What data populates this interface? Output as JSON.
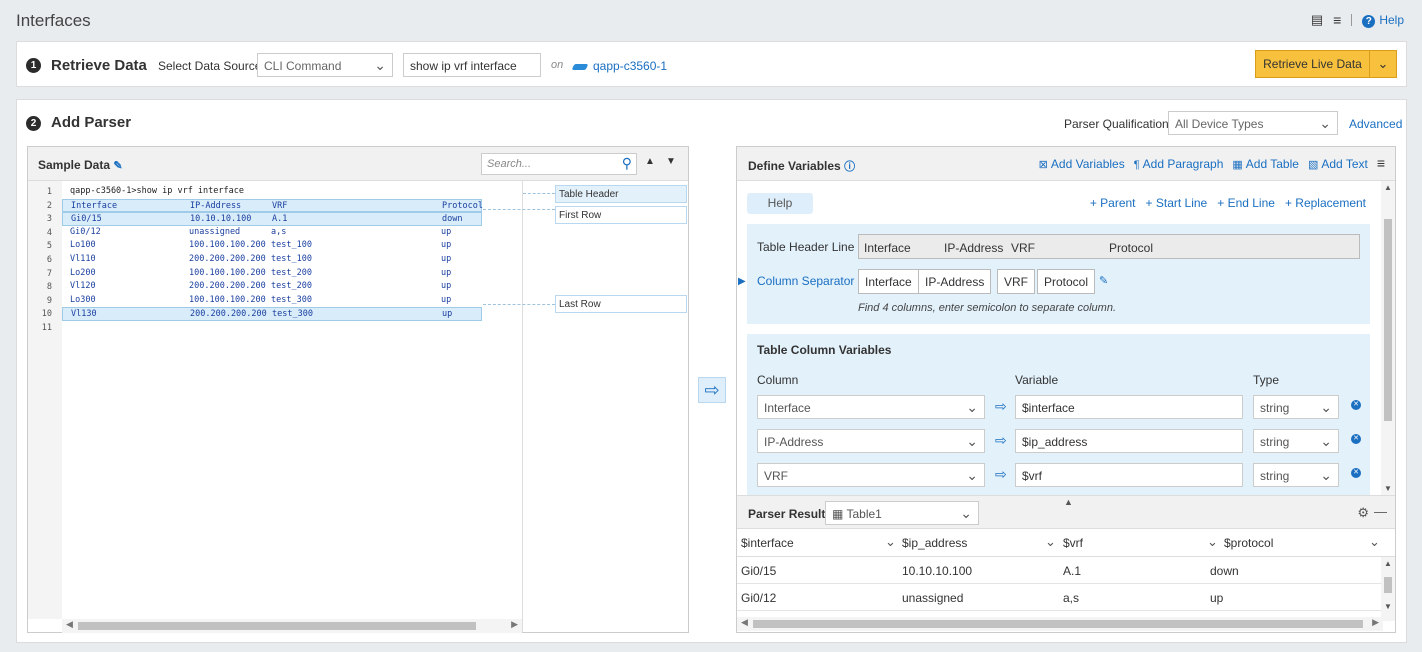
{
  "page": {
    "title": "Interfaces",
    "help_label": "Help"
  },
  "step1": {
    "number": "1",
    "title": "Retrieve Data",
    "source_label": "Select Data Source",
    "source_value": "CLI Command",
    "command_value": "show ip vrf interface",
    "on_label": "on",
    "device_name": "qapp-c3560-1",
    "retrieve_button": "Retrieve Live Data"
  },
  "step2": {
    "number": "2",
    "title": "Add Parser",
    "qualification_label": "Parser Qualification",
    "qualification_value": "All Device Types",
    "advanced_link": "Advanced"
  },
  "sample": {
    "title": "Sample Data",
    "search_placeholder": "Search...",
    "lines": [
      {
        "n": "1",
        "cells": [
          "qapp-c3560-1>show ip vrf interface",
          "",
          "",
          ""
        ],
        "hl": false,
        "prompt": true
      },
      {
        "n": "2",
        "cells": [
          "Interface",
          "IP-Address",
          "VRF",
          "Protocol"
        ],
        "hl": true
      },
      {
        "n": "3",
        "cells": [
          "Gi0/15",
          "10.10.10.100",
          "A.1",
          "down"
        ],
        "hl": true
      },
      {
        "n": "4",
        "cells": [
          "Gi0/12",
          "unassigned",
          "a,s",
          "up"
        ],
        "hl": false
      },
      {
        "n": "5",
        "cells": [
          "Lo100",
          "100.100.100.200",
          "test_100",
          "up"
        ],
        "hl": false
      },
      {
        "n": "6",
        "cells": [
          "Vl110",
          "200.200.200.200",
          "test_100",
          "up"
        ],
        "hl": false
      },
      {
        "n": "7",
        "cells": [
          "Lo200",
          "100.100.100.200",
          "test_200",
          "up"
        ],
        "hl": false
      },
      {
        "n": "8",
        "cells": [
          "Vl120",
          "200.200.200.200",
          "test_200",
          "up"
        ],
        "hl": false
      },
      {
        "n": "9",
        "cells": [
          "Lo300",
          "100.100.100.200",
          "test_300",
          "up"
        ],
        "hl": false
      },
      {
        "n": "10",
        "cells": [
          "Vl130",
          "200.200.200.200",
          "test_300",
          "up"
        ],
        "hl": true
      },
      {
        "n": "11",
        "cells": [
          "",
          "",
          "",
          ""
        ],
        "hl": false
      }
    ],
    "markers": {
      "table_header": "Table Header",
      "first_row": "First Row",
      "last_row": "Last Row"
    }
  },
  "define": {
    "title": "Define Variables",
    "tools": {
      "add_variables": "Add Variables",
      "add_paragraph": "Add Paragraph",
      "add_table": "Add Table",
      "add_text": "Add Text"
    },
    "help_tab": "Help",
    "links": {
      "parent": "+ Parent",
      "start_line": "+ Start Line",
      "end_line": "+ End Line",
      "replacement": "+ Replacement"
    },
    "table_header_label": "Table Header Line",
    "table_header_cells": [
      "Interface",
      "IP-Address",
      "VRF",
      "Protocol"
    ],
    "column_separator_label": "Column Separator",
    "separator_cells": [
      "Interface",
      "IP-Address",
      "VRF",
      "Protocol"
    ],
    "find_text": "Find 4 columns, enter semicolon to separate column.",
    "column_vars_title": "Table Column Variables",
    "col_header": "Column",
    "var_header": "Variable",
    "type_header": "Type",
    "rows": [
      {
        "column": "Interface",
        "variable": "$interface",
        "type": "string"
      },
      {
        "column": "IP-Address",
        "variable": "$ip_address",
        "type": "string"
      },
      {
        "column": "VRF",
        "variable": "$vrf",
        "type": "string"
      }
    ]
  },
  "result": {
    "title": "Parser Result",
    "table_value": "Table1",
    "columns": [
      "$interface",
      "$ip_address",
      "$vrf",
      "$protocol"
    ],
    "rows": [
      [
        "Gi0/15",
        "10.10.10.100",
        "A.1",
        "down"
      ],
      [
        "Gi0/12",
        "unassigned",
        "a,s",
        "up"
      ]
    ]
  }
}
